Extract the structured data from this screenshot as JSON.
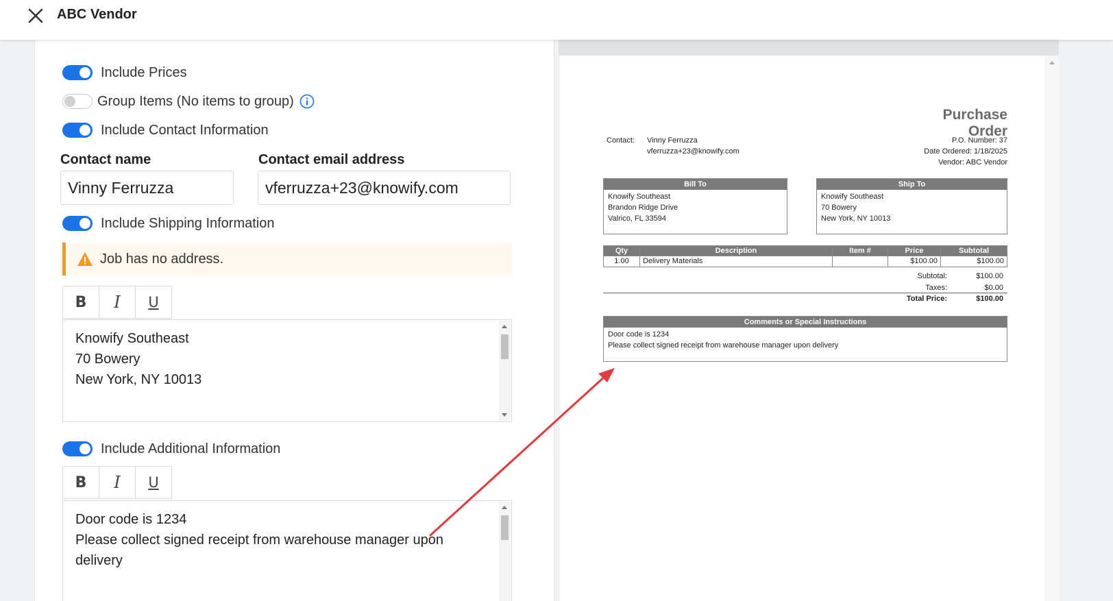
{
  "header": {
    "title": "ABC Vendor"
  },
  "left": {
    "toggles": {
      "include_prices": {
        "label": "Include Prices",
        "on": true
      },
      "group_items": {
        "label": "Group Items (No items to group)",
        "on": false
      },
      "include_contact": {
        "label": "Include Contact Information",
        "on": true
      },
      "include_shipping": {
        "label": "Include Shipping Information",
        "on": true
      },
      "include_additional": {
        "label": "Include Additional Information",
        "on": true
      }
    },
    "contact_name": {
      "label": "Contact name",
      "value": "Vinny Ferruzza"
    },
    "contact_email": {
      "label": "Contact email address",
      "value": "vferruzza+23@knowify.com"
    },
    "alert": {
      "text": "Job has no address."
    },
    "format_buttons": {
      "bold": "B",
      "italic": "I",
      "underline": "U"
    },
    "shipping_text": [
      "Knowify Southeast",
      "70 Bowery",
      "New York, NY 10013"
    ],
    "additional_text": [
      "Door code is 1234",
      "Please collect signed receipt from warehouse manager upon",
      "delivery"
    ]
  },
  "preview": {
    "title": "Purchase Order",
    "contact_label": "Contact:",
    "contact_name": "Vinny Ferruzza",
    "contact_email": "vferruzza+23@knowify.com",
    "po_number": "P.O. Number: 37",
    "date_ordered": "Date Ordered: 1/18/2025",
    "vendor": "Vendor: ABC Vendor",
    "bill_to": {
      "heading": "Bill To",
      "lines": [
        "Knowify Southeast",
        "Brandon Ridge Drive",
        "Valrico, FL 33594"
      ]
    },
    "ship_to": {
      "heading": "Ship To",
      "lines": [
        "Knowify Southeast",
        "70 Bowery",
        "New York, NY 10013"
      ]
    },
    "table": {
      "headers": [
        "Qty",
        "Description",
        "Item #",
        "Price",
        "Subtotal"
      ],
      "rows": [
        [
          "1.00",
          "Delivery Materials",
          "",
          "$100.00",
          "$100.00"
        ]
      ]
    },
    "totals": {
      "subtotal_label": "Subtotal:",
      "subtotal": "$100.00",
      "taxes_label": "Taxes:",
      "taxes": "$0.00",
      "total_label": "Total Price:",
      "total": "$100.00"
    },
    "comments": {
      "heading": "Comments or Special Instructions",
      "lines": [
        "Door code is 1234",
        "Please collect signed receipt from warehouse manager upon delivery"
      ]
    }
  },
  "colors": {
    "toggle_on": "#1a73e8",
    "alert_border": "#f29a1f",
    "arrow": "#e0393e"
  }
}
